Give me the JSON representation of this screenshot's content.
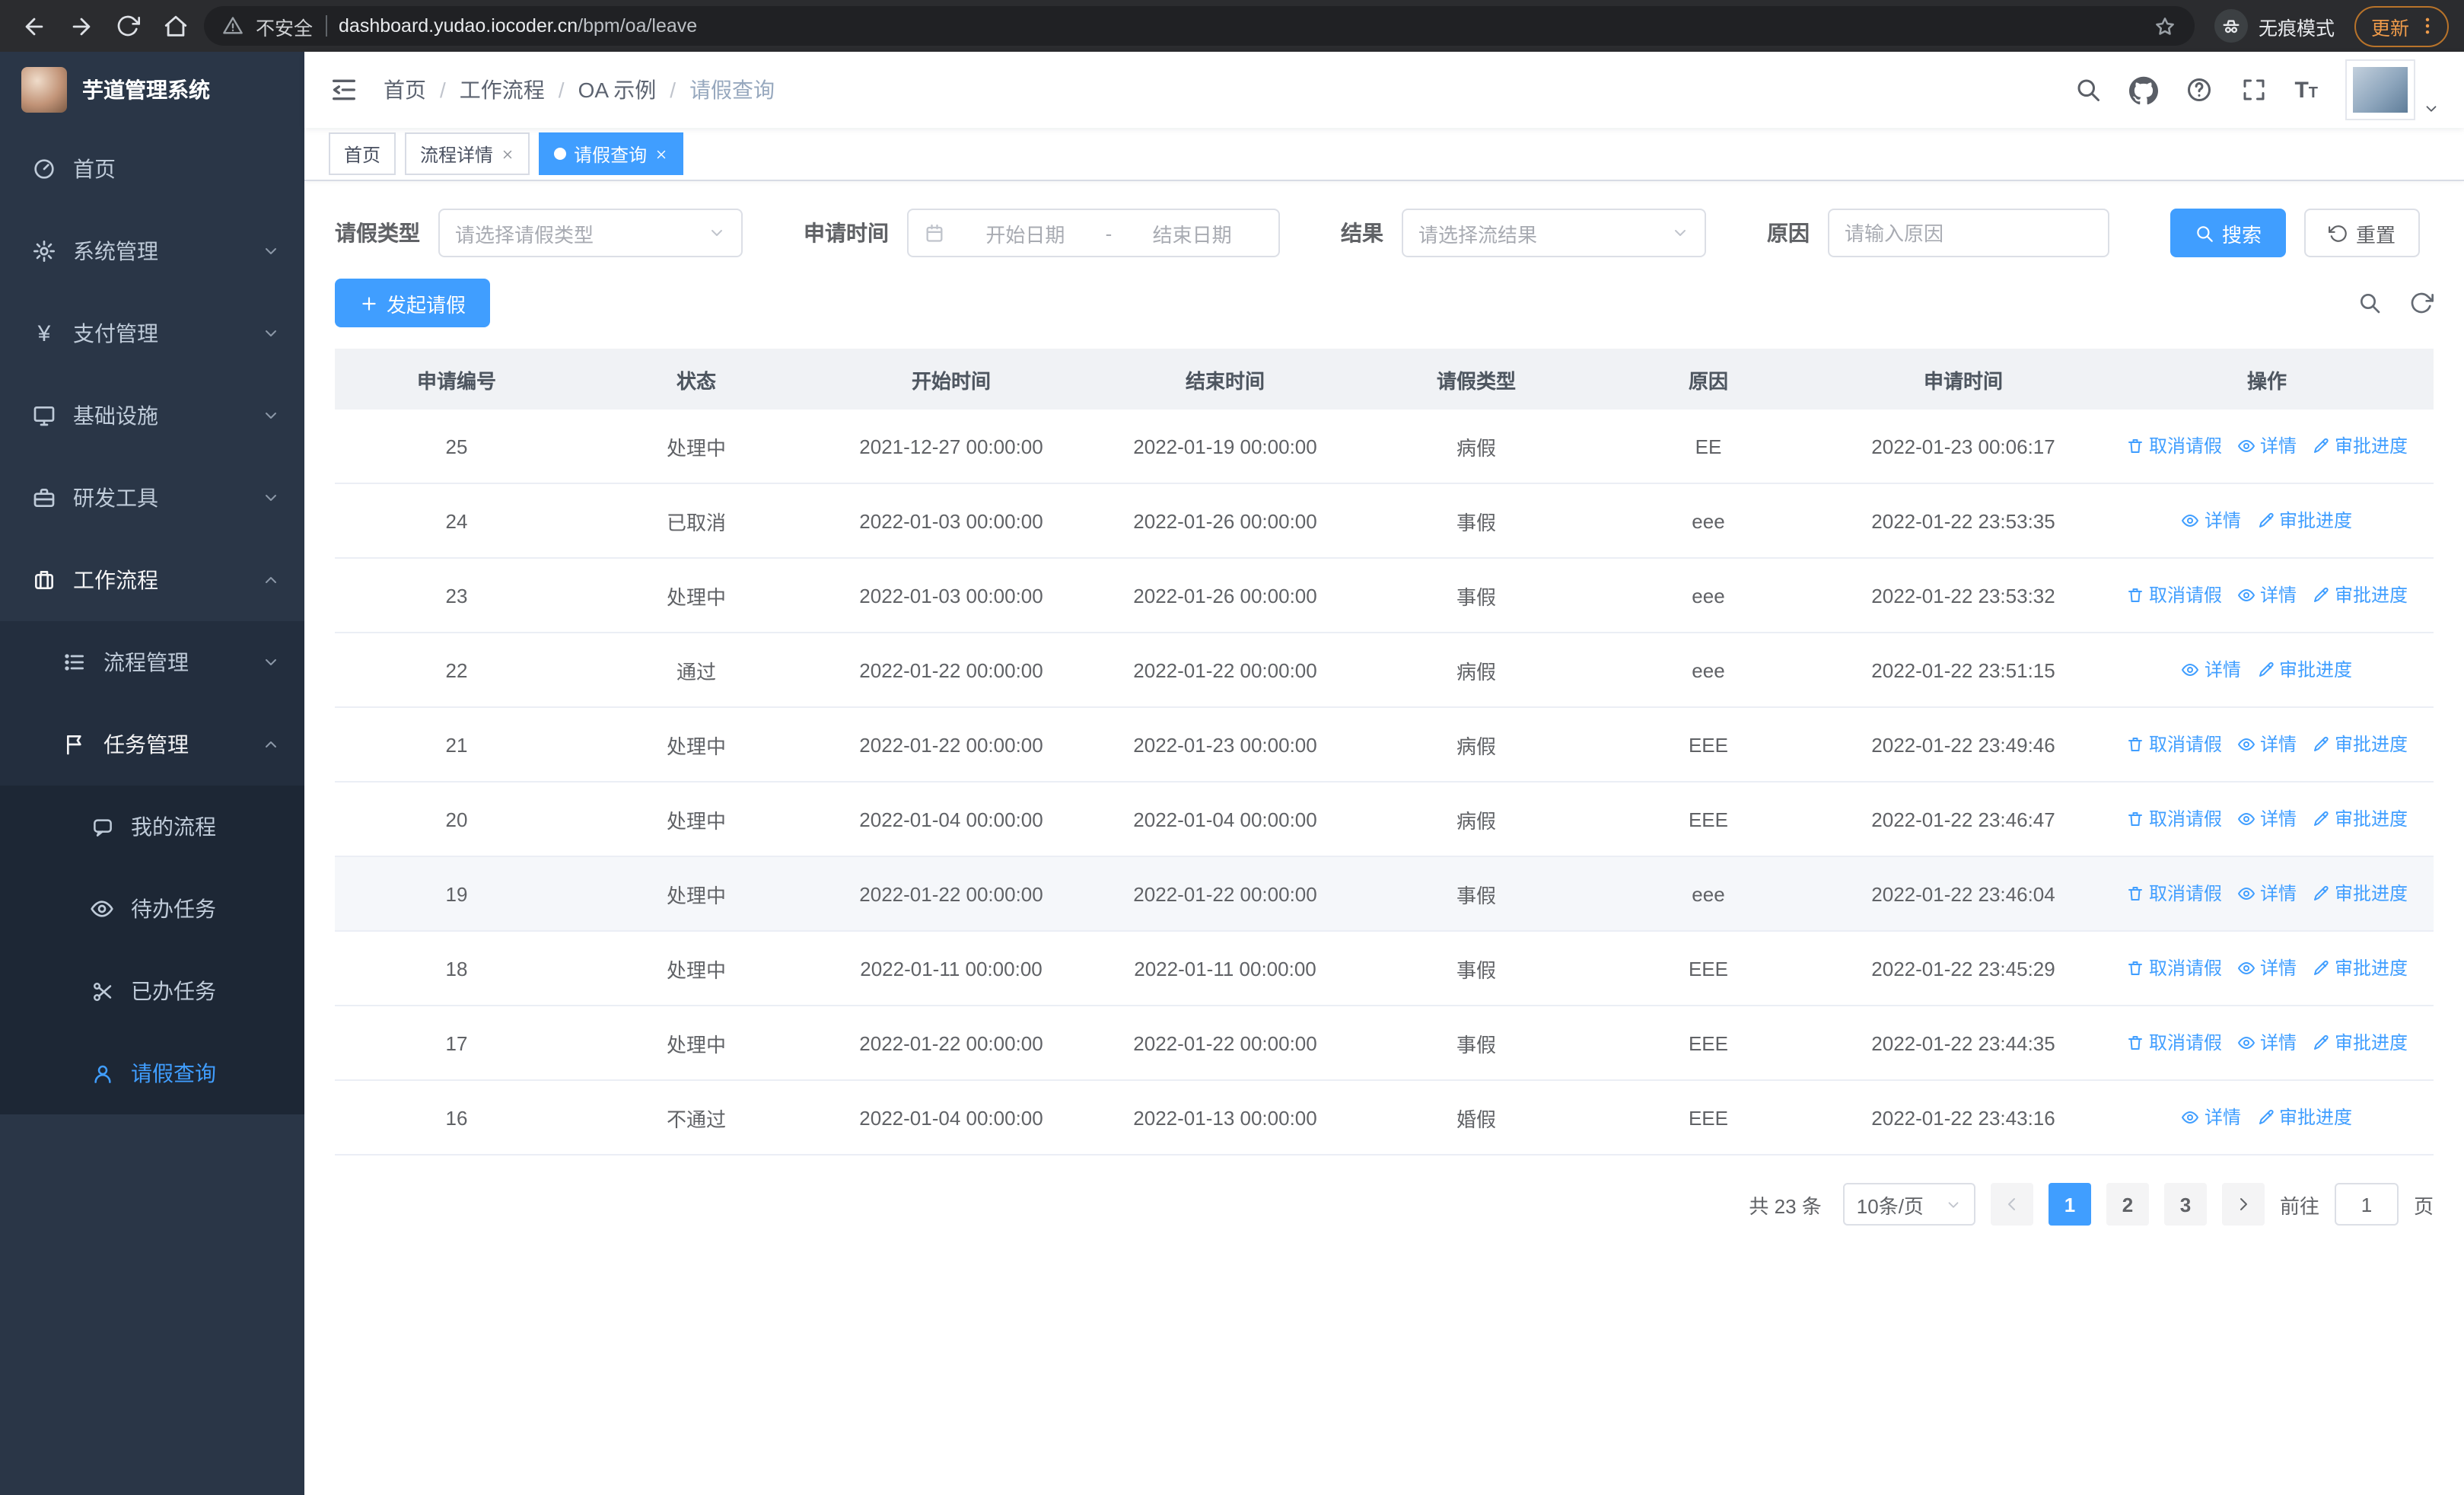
{
  "colors": {
    "primary": "#409eff",
    "sidebar_bg": "#2a3647",
    "sidebar_submenu_bg": "#1d2735",
    "table_header_bg": "#f0f2f5",
    "chrome_bg": "#2b2c2f",
    "update_accent": "#ef9b4a"
  },
  "browser": {
    "security_label": "不安全",
    "url_domain": "dashboard.yudao.iocoder.cn",
    "url_path": "/bpm/oa/leave",
    "incognito_label": "无痕模式",
    "update_label": "更新"
  },
  "sidebar": {
    "app_title": "芋道管理系统",
    "home": "首页",
    "system": "系统管理",
    "payment": "支付管理",
    "infra": "基础设施",
    "devtools": "研发工具",
    "workflow": "工作流程",
    "process_mgmt": "流程管理",
    "task_mgmt": "任务管理",
    "my_process": "我的流程",
    "todo_tasks": "待办任务",
    "done_tasks": "已办任务",
    "leave_query": "请假查询"
  },
  "header": {
    "breadcrumb": [
      "首页",
      "工作流程",
      "OA 示例",
      "请假查询"
    ]
  },
  "tabs": [
    {
      "label": "首页"
    },
    {
      "label": "流程详情"
    },
    {
      "label": "请假查询"
    }
  ],
  "filters": {
    "leave_type_label": "请假类型",
    "leave_type_placeholder": "请选择请假类型",
    "apply_time_label": "申请时间",
    "date_start_placeholder": "开始日期",
    "date_separator": "-",
    "date_end_placeholder": "结束日期",
    "result_label": "结果",
    "result_placeholder": "请选择流结果",
    "reason_label": "原因",
    "reason_placeholder": "请输入原因",
    "search_button": "搜索",
    "reset_button": "重置"
  },
  "toolbar": {
    "create_button": "发起请假"
  },
  "icons": {
    "row_cancel": "trash-icon",
    "row_detail": "eye-icon",
    "row_progress": "edit-icon"
  },
  "table": {
    "columns": [
      "申请编号",
      "状态",
      "开始时间",
      "结束时间",
      "请假类型",
      "原因",
      "申请时间",
      "操作"
    ],
    "action_labels": {
      "cancel": "取消请假",
      "detail": "详情",
      "progress": "审批进度"
    },
    "rows": [
      {
        "id": "25",
        "status": "处理中",
        "start": "2021-12-27 00:00:00",
        "end": "2022-01-19 00:00:00",
        "type": "病假",
        "reason": "EE",
        "applied": "2022-01-23 00:06:17",
        "actions": [
          "cancel",
          "detail",
          "progress"
        ]
      },
      {
        "id": "24",
        "status": "已取消",
        "start": "2022-01-03 00:00:00",
        "end": "2022-01-26 00:00:00",
        "type": "事假",
        "reason": "eee",
        "applied": "2022-01-22 23:53:35",
        "actions": [
          "detail",
          "progress"
        ]
      },
      {
        "id": "23",
        "status": "处理中",
        "start": "2022-01-03 00:00:00",
        "end": "2022-01-26 00:00:00",
        "type": "事假",
        "reason": "eee",
        "applied": "2022-01-22 23:53:32",
        "actions": [
          "cancel",
          "detail",
          "progress"
        ]
      },
      {
        "id": "22",
        "status": "通过",
        "start": "2022-01-22 00:00:00",
        "end": "2022-01-22 00:00:00",
        "type": "病假",
        "reason": "eee",
        "applied": "2022-01-22 23:51:15",
        "actions": [
          "detail",
          "progress"
        ]
      },
      {
        "id": "21",
        "status": "处理中",
        "start": "2022-01-22 00:00:00",
        "end": "2022-01-23 00:00:00",
        "type": "病假",
        "reason": "EEE",
        "applied": "2022-01-22 23:49:46",
        "actions": [
          "cancel",
          "detail",
          "progress"
        ]
      },
      {
        "id": "20",
        "status": "处理中",
        "start": "2022-01-04 00:00:00",
        "end": "2022-01-04 00:00:00",
        "type": "病假",
        "reason": "EEE",
        "applied": "2022-01-22 23:46:47",
        "actions": [
          "cancel",
          "detail",
          "progress"
        ]
      },
      {
        "id": "19",
        "status": "处理中",
        "start": "2022-01-22 00:00:00",
        "end": "2022-01-22 00:00:00",
        "type": "事假",
        "reason": "eee",
        "applied": "2022-01-22 23:46:04",
        "actions": [
          "cancel",
          "detail",
          "progress"
        ],
        "highlight": true
      },
      {
        "id": "18",
        "status": "处理中",
        "start": "2022-01-11 00:00:00",
        "end": "2022-01-11 00:00:00",
        "type": "事假",
        "reason": "EEE",
        "applied": "2022-01-22 23:45:29",
        "actions": [
          "cancel",
          "detail",
          "progress"
        ]
      },
      {
        "id": "17",
        "status": "处理中",
        "start": "2022-01-22 00:00:00",
        "end": "2022-01-22 00:00:00",
        "type": "事假",
        "reason": "EEE",
        "applied": "2022-01-22 23:44:35",
        "actions": [
          "cancel",
          "detail",
          "progress"
        ]
      },
      {
        "id": "16",
        "status": "不通过",
        "start": "2022-01-04 00:00:00",
        "end": "2022-01-13 00:00:00",
        "type": "婚假",
        "reason": "EEE",
        "applied": "2022-01-22 23:43:16",
        "actions": [
          "detail",
          "progress"
        ]
      }
    ]
  },
  "pagination": {
    "total_text": "共 23 条",
    "page_size": "10条/页",
    "pages": [
      "1",
      "2",
      "3"
    ],
    "active_page": "1",
    "goto_prefix": "前往",
    "goto_value": "1",
    "goto_suffix": "页"
  }
}
